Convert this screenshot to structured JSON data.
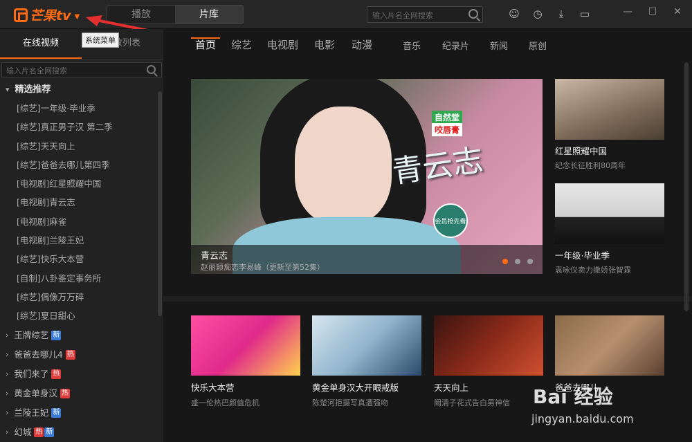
{
  "app": {
    "logo_text": "芒果tv",
    "brand_color": "#ff6a13"
  },
  "top_tabs": [
    "播放",
    "片库"
  ],
  "top_search": {
    "placeholder": "输入片名全网搜索"
  },
  "tooltip": "系统菜单",
  "sidebar": {
    "tabs": [
      "在线视频",
      "播放列表"
    ],
    "search_placeholder": "输入片名全网搜索",
    "group_title": "精选推荐",
    "items": [
      "[综艺]一年级·毕业季",
      "[综艺]真正男子汉 第二季",
      "[综艺]天天向上",
      "[综艺]爸爸去哪儿第四季",
      "[电视剧]红星照耀中国",
      "[电视剧]青云志",
      "[电视剧]麻雀",
      "[电视剧]兰陵王妃",
      "[综艺]快乐大本营",
      "[自制]八卦鉴定事务所",
      "[综艺]偶像万万碎",
      "[综艺]夏日甜心"
    ],
    "categories": [
      {
        "label": "王牌综艺",
        "badges": [
          "新"
        ]
      },
      {
        "label": "爸爸去哪儿4",
        "badges": [
          "热"
        ]
      },
      {
        "label": "我们来了",
        "badges": [
          "热"
        ]
      },
      {
        "label": "黄金单身汉",
        "badges": [
          "热"
        ]
      },
      {
        "label": "兰陵王妃",
        "badges": [
          "新"
        ]
      },
      {
        "label": "幻城",
        "badges": [
          "热",
          "新"
        ]
      }
    ]
  },
  "nav": {
    "primary": [
      "首页",
      "综艺",
      "电视剧",
      "电影",
      "动漫"
    ],
    "secondary": [
      "音乐",
      "纪录片",
      "新闻",
      "原创"
    ]
  },
  "hero": {
    "title": "青云志",
    "subtitle": "赵丽颖痴恋李易峰（更新至第52集）",
    "tag1": "自然堂",
    "tag2": "咬唇膏",
    "calligraphy": "青云志",
    "member_badge": "会员抢先看"
  },
  "side_cards": [
    {
      "title": "红星照耀中国",
      "subtitle": "纪念长征胜利80周年"
    },
    {
      "title": "一年级·毕业季",
      "subtitle": "袁咏仪卖力撒娇张智霖"
    }
  ],
  "grid_cards": [
    {
      "title": "快乐大本营",
      "subtitle": "盛一伦热巴颜值危机"
    },
    {
      "title": "黄金单身汉大开眼戒版",
      "subtitle": "陈楚河拒摄写真遭强吻"
    },
    {
      "title": "天天向上",
      "subtitle": "阚清子花式告白男神信"
    },
    {
      "title": "爸爸去哪儿",
      "subtitle": ""
    }
  ],
  "watermark": {
    "line1": "Bai 经验",
    "line2": "jingyan.baidu.com"
  }
}
